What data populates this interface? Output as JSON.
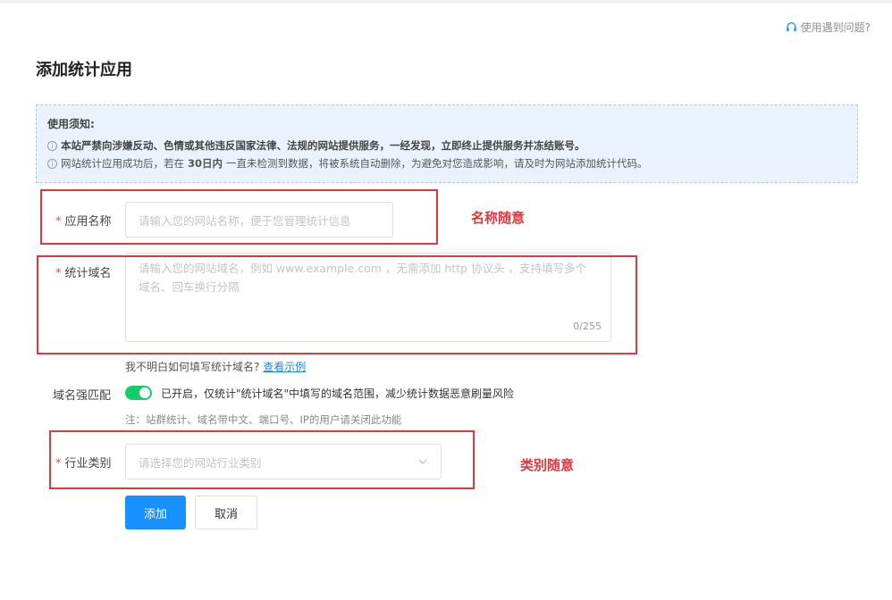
{
  "help_link": "使用遇到问题?",
  "page_title": "添加统计应用",
  "notice": {
    "title": "使用须知:",
    "line1": "本站严禁向涉嫌反动、色情或其他违反国家法律、法规的网站提供服务，一经发现，立即终止提供服务并冻结账号。",
    "line2_pre": "网站统计应用成功后，若在",
    "line2_bold": "30日内",
    "line2_post": "一直未检测到数据，将被系统自动删除，为避免对您造成影响，请及时为网站添加统计代码。"
  },
  "form": {
    "required_mark": "*",
    "app_name": {
      "label": "应用名称",
      "placeholder": "请输入您的网站名称，便于您管理统计信息"
    },
    "domain": {
      "label": "统计域名",
      "placeholder_line1": "请输入您的网站域名，例如 www.example.com ，无需添加 http 协议头 ，支持填写多个",
      "placeholder_line2": "域名、回车换行分隔",
      "counter": "0/255"
    },
    "domain_hint": "我不明白如何填写统计域名?",
    "domain_hint_link": "查看示例",
    "strict_match": {
      "label": "域名强匹配",
      "enabled": true,
      "text": "已开启，仅统计\"统计域名\"中填写的域名范围，减少统计数据恶意刷量风险",
      "note": "注：站群统计、域名带中文、端口号、IP的用户请关闭此功能"
    },
    "industry": {
      "label": "行业类别",
      "placeholder": "请选择您的网站行业类别"
    },
    "submit_label": "添加",
    "cancel_label": "取消"
  },
  "annotations": {
    "name_note": "名称随意",
    "category_note": "类别随意"
  },
  "colors": {
    "primary": "#1890ff",
    "toggle_on": "#13ce66",
    "annotation_red": "#e0383e",
    "notice_bg": "#eaf3fd"
  }
}
